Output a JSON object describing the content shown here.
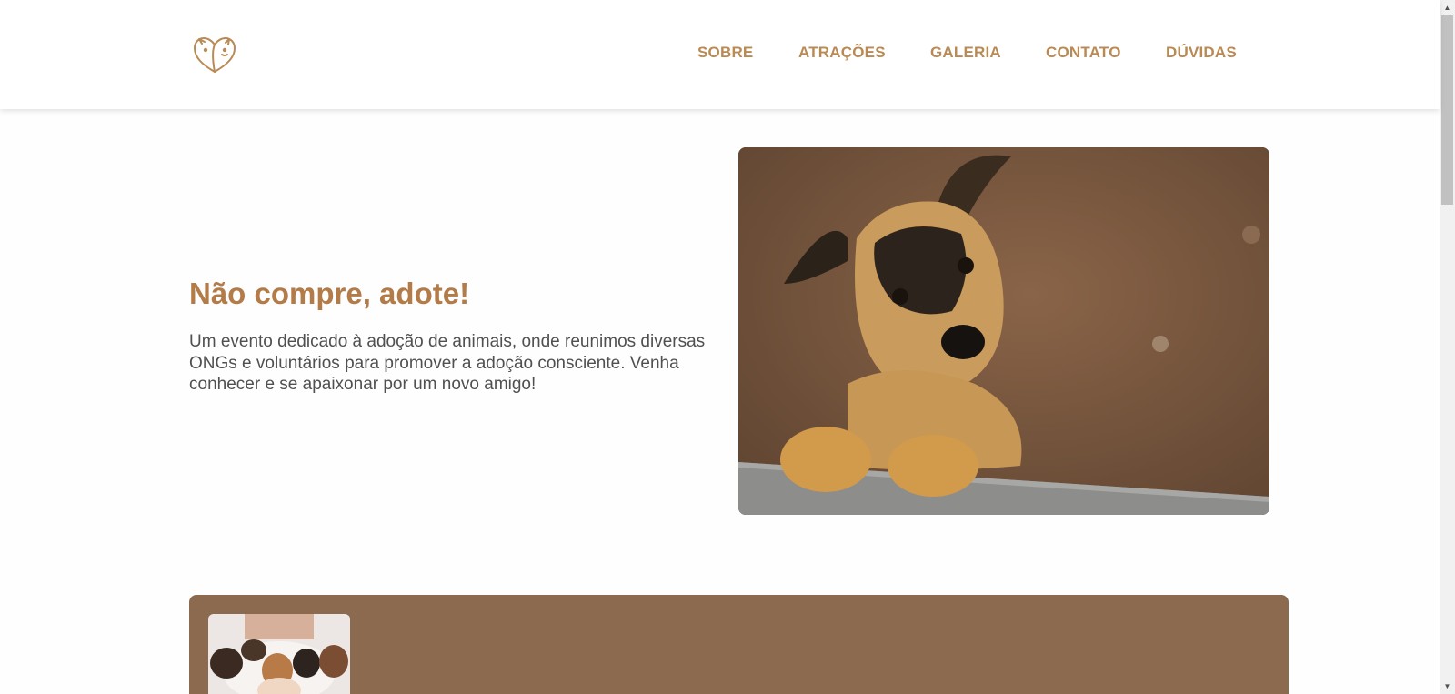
{
  "header": {
    "logo_icon": "heart-pets-logo-icon",
    "nav": [
      {
        "label": "SOBRE"
      },
      {
        "label": "ATRAÇÕES"
      },
      {
        "label": "GALERIA"
      },
      {
        "label": "CONTATO"
      },
      {
        "label": "DÚVIDAS"
      }
    ]
  },
  "hero": {
    "title": "Não compre, adote!",
    "description": "Um evento dedicado à adoção de animais, onde reunimos diversas ONGs e voluntários para promover a adoção consciente. Venha conhecer e se apaixonar por um novo amigo!",
    "image_subject": "puppy-photo"
  },
  "section": {
    "thumbnail_subject": "puppies-held-photo"
  },
  "colors": {
    "accent": "#b98a54",
    "title": "#b27b48",
    "band": "#8b6a50",
    "text": "#505050"
  },
  "scrollbar": {
    "up_arrow": "▲",
    "down_arrow": "▼"
  }
}
